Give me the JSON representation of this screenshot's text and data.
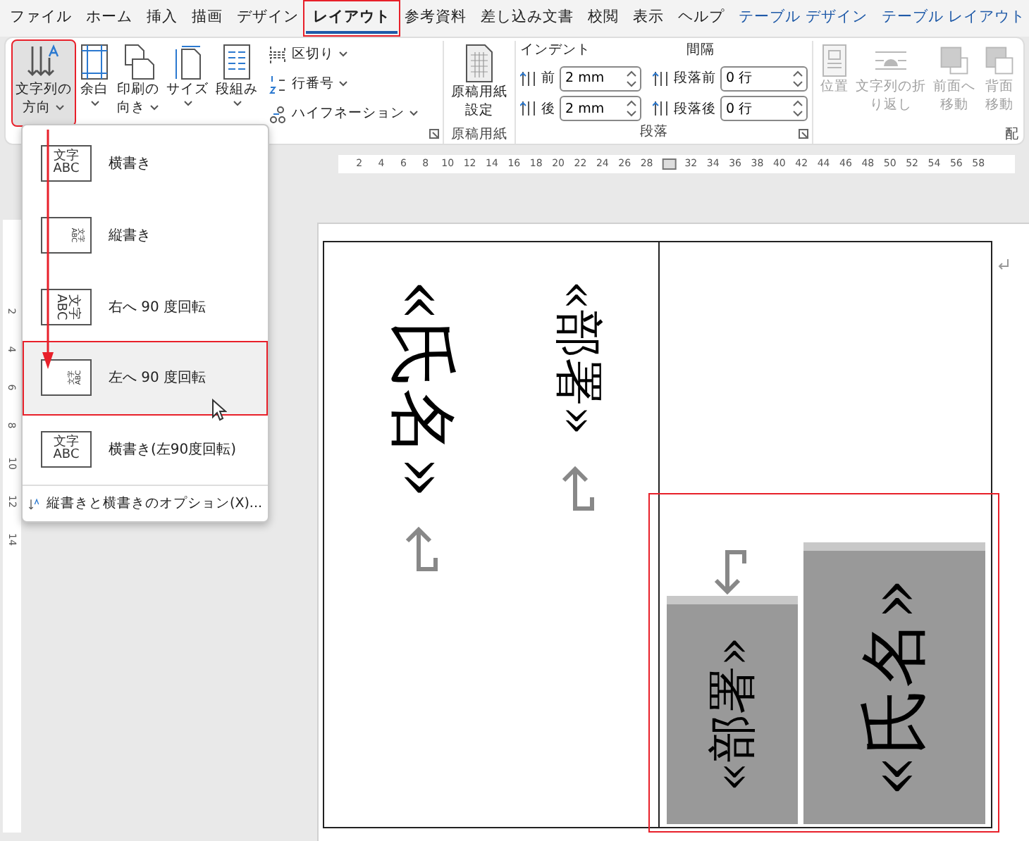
{
  "tabs": [
    {
      "label": "ファイル",
      "selected": false,
      "kind": "normal",
      "annotated": false
    },
    {
      "label": "ホーム",
      "selected": false,
      "kind": "normal",
      "annotated": false
    },
    {
      "label": "挿入",
      "selected": false,
      "kind": "normal",
      "annotated": false
    },
    {
      "label": "描画",
      "selected": false,
      "kind": "normal",
      "annotated": false
    },
    {
      "label": "デザイン",
      "selected": false,
      "kind": "normal",
      "annotated": false
    },
    {
      "label": "レイアウト",
      "selected": true,
      "kind": "normal",
      "annotated": true
    },
    {
      "label": "参考資料",
      "selected": false,
      "kind": "normal",
      "annotated": false
    },
    {
      "label": "差し込み文書",
      "selected": false,
      "kind": "normal",
      "annotated": false
    },
    {
      "label": "校閲",
      "selected": false,
      "kind": "normal",
      "annotated": false
    },
    {
      "label": "表示",
      "selected": false,
      "kind": "normal",
      "annotated": false
    },
    {
      "label": "ヘルプ",
      "selected": false,
      "kind": "normal",
      "annotated": false
    },
    {
      "label": "テーブル デザイン",
      "selected": false,
      "kind": "contextual",
      "annotated": false
    },
    {
      "label": "テーブル レイアウト",
      "selected": false,
      "kind": "contextual",
      "annotated": false
    }
  ],
  "ribbon": {
    "page_setup": {
      "large_buttons": [
        {
          "lines": [
            "文字列の",
            "方向"
          ],
          "pressed": true,
          "annotated": true
        },
        {
          "lines": [
            "余白"
          ],
          "pressed": false,
          "annotated": false
        },
        {
          "lines": [
            "印刷の",
            "向き"
          ],
          "pressed": false,
          "annotated": false
        },
        {
          "lines": [
            "サイズ"
          ],
          "pressed": false,
          "annotated": false
        },
        {
          "lines": [
            "段組み"
          ],
          "pressed": false,
          "annotated": false
        }
      ],
      "small_buttons": [
        {
          "label": "区切り"
        },
        {
          "label": "行番号"
        },
        {
          "label": "ハイフネーション"
        }
      ]
    },
    "manuscript": {
      "button": [
        "原稿用紙",
        "設定"
      ],
      "group_label": "原稿用紙"
    },
    "paragraph": {
      "indent_label": "インデント",
      "indent_fields": [
        {
          "label": "前",
          "value": "2 mm"
        },
        {
          "label": "後",
          "value": "2 mm"
        }
      ],
      "spacing_label": "間隔",
      "spacing_fields": [
        {
          "label": "段落前",
          "value": "0 行"
        },
        {
          "label": "段落後",
          "value": "0 行"
        }
      ],
      "group_label": "段落"
    },
    "arrange": {
      "buttons": [
        {
          "lines": [
            "位置"
          ],
          "disabled": true
        },
        {
          "lines": [
            "文字列の折",
            "り返し"
          ],
          "disabled": true
        },
        {
          "lines": [
            "前面へ",
            "移動"
          ],
          "disabled": true
        },
        {
          "lines": [
            "背面",
            "移動"
          ],
          "disabled": true
        }
      ],
      "group_label": "配"
    }
  },
  "ruler": {
    "left_numbers": [
      "2",
      "4",
      "6",
      "8",
      "10",
      "12",
      "14",
      "16",
      "18",
      "20",
      "22",
      "24",
      "26",
      "28"
    ],
    "right_numbers": [
      "32",
      "34",
      "36",
      "38",
      "40",
      "42",
      "44",
      "46",
      "48",
      "50",
      "52",
      "54",
      "56",
      "58"
    ],
    "vertical_numbers": [
      "2",
      "4",
      "6",
      "8",
      "10",
      "12",
      "14"
    ]
  },
  "dropdown": {
    "items": [
      {
        "label": "横書き",
        "preview_lines": [
          "文字",
          "ABC"
        ],
        "selected": false,
        "annotated": false
      },
      {
        "label": "縦書き",
        "preview_lines": [
          "文字",
          "ABC"
        ],
        "selected": false,
        "annotated": false
      },
      {
        "label": "右へ 90 度回転",
        "preview_lines": [
          "文字",
          "ABC"
        ],
        "selected": false,
        "annotated": false
      },
      {
        "label": "左へ 90 度回転",
        "preview_lines": [
          "文字",
          "ABC"
        ],
        "selected": true,
        "annotated": true
      },
      {
        "label": "横書き(左90度回転)",
        "preview_lines": [
          "文字",
          "ABC"
        ],
        "selected": false,
        "annotated": false
      }
    ],
    "footer": "縦書きと横書きのオプション(X)..."
  },
  "document": {
    "cells": [
      {
        "selected": false,
        "annotated": false,
        "texts": [
          "«氏名»",
          "«部署»"
        ]
      },
      {
        "selected": true,
        "annotated": true,
        "texts": [
          "«部署»",
          "«氏名»"
        ]
      }
    ]
  }
}
